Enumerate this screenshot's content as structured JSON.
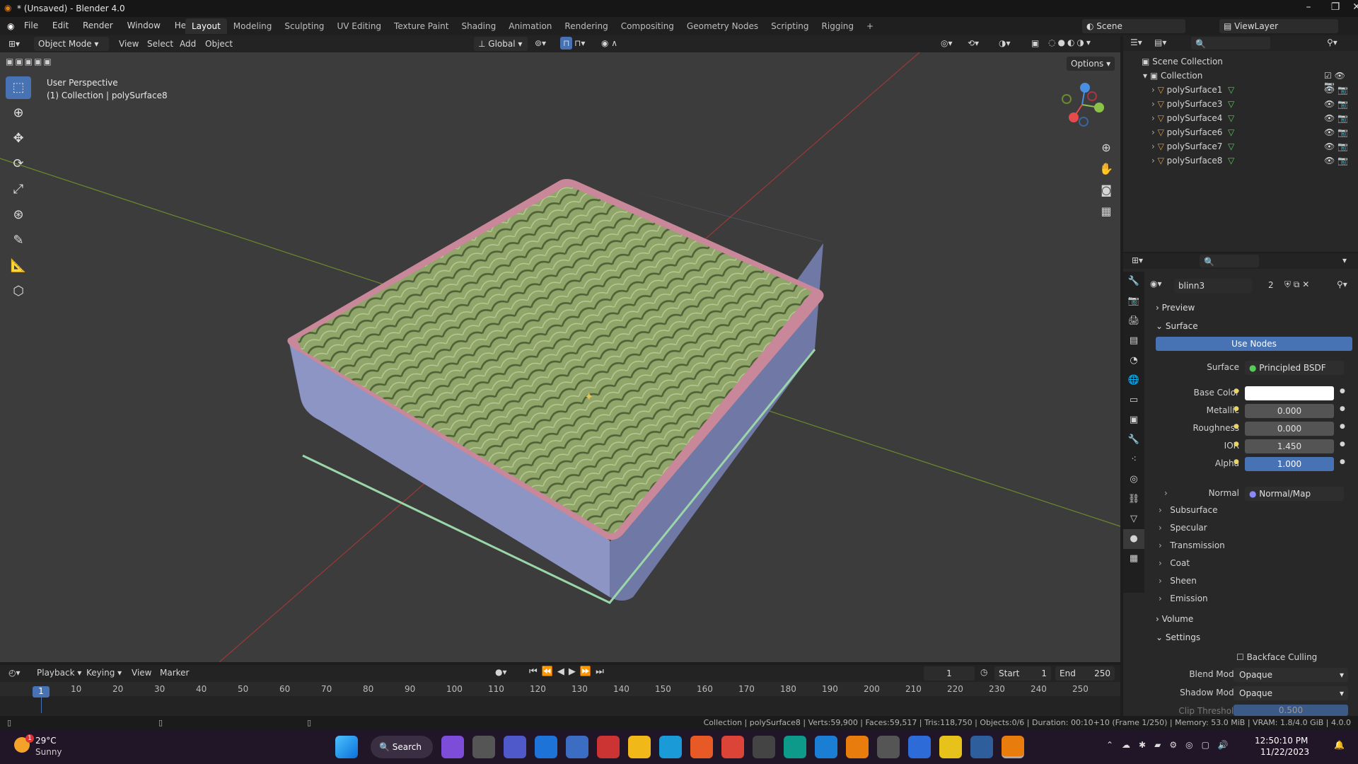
{
  "window": {
    "title": "* (Unsaved) - Blender 4.0"
  },
  "menu": [
    "File",
    "Edit",
    "Render",
    "Window",
    "Help"
  ],
  "workspaces": [
    "Layout",
    "Modeling",
    "Sculpting",
    "UV Editing",
    "Texture Paint",
    "Shading",
    "Animation",
    "Rendering",
    "Compositing",
    "Geometry Nodes",
    "Scripting",
    "Rigging"
  ],
  "scene": "Scene",
  "view_layer": "ViewLayer",
  "viewport_header": {
    "mode": "Object Mode",
    "menus": [
      "View",
      "Select",
      "Add",
      "Object"
    ],
    "orientation": "Global",
    "options": "Options"
  },
  "viewport": {
    "perspective": "User Perspective",
    "collection_info": "(1) Collection | polySurface8"
  },
  "outliner": {
    "root": "Scene Collection",
    "collection": "Collection",
    "items": [
      "polySurface1",
      "polySurface3",
      "polySurface4",
      "polySurface6",
      "polySurface7",
      "polySurface8"
    ]
  },
  "material": {
    "name": "blinn3",
    "users": "2"
  },
  "props": {
    "preview": "Preview",
    "surface_section": "Surface",
    "use_nodes": "Use Nodes",
    "surface_label": "Surface",
    "surface_value": "Principled BSDF",
    "fields": [
      {
        "label": "Base Color",
        "value": ""
      },
      {
        "label": "Metallic",
        "value": "0.000"
      },
      {
        "label": "Roughness",
        "value": "0.000"
      },
      {
        "label": "IOR",
        "value": "1.450"
      },
      {
        "label": "Alpha",
        "value": "1.000"
      }
    ],
    "normal_label": "Normal",
    "normal_value": "Normal/Map",
    "subs": [
      "Subsurface",
      "Specular",
      "Transmission",
      "Coat",
      "Sheen",
      "Emission"
    ],
    "volume": "Volume",
    "settings": "Settings",
    "backface": "Backface Culling",
    "blend_label": "Blend Mode",
    "blend_value": "Opaque",
    "shadow_label": "Shadow Mode",
    "shadow_value": "Opaque",
    "clip_label": "Clip Threshold",
    "clip_value": "0.500"
  },
  "timeline": {
    "menus": [
      "Playback",
      "Keying",
      "View",
      "Marker"
    ],
    "current": "1",
    "start_label": "Start",
    "start": "1",
    "end_label": "End",
    "end": "250",
    "ticks": [
      "1",
      "10",
      "20",
      "30",
      "40",
      "50",
      "60",
      "70",
      "80",
      "90",
      "100",
      "110",
      "120",
      "130",
      "140",
      "150",
      "160",
      "170",
      "180",
      "190",
      "200",
      "210",
      "220",
      "230",
      "240",
      "250"
    ]
  },
  "status": "Collection | polySurface8 | Verts:59,900 | Faces:59,517 | Tris:118,750 | Objects:0/6 | Duration: 00:10+10 (Frame 1/250) | Memory: 53.0 MiB | VRAM: 1.8/4.0 GiB | 4.0.0",
  "taskbar": {
    "temp": "29°C",
    "weather": "Sunny",
    "search": "Search",
    "time": "12:50:10 PM",
    "date": "11/22/2023",
    "badge": "1"
  }
}
